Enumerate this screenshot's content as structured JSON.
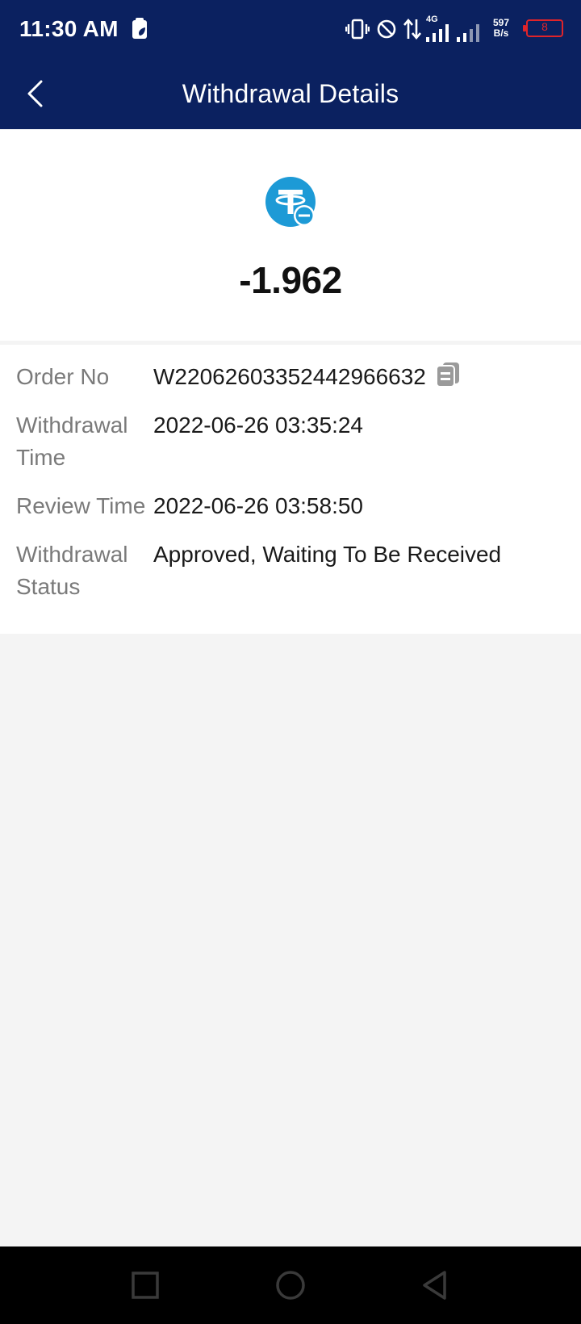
{
  "status_bar": {
    "time": "11:30 AM",
    "network": "4G",
    "speed_value": "597",
    "speed_unit": "B/s",
    "battery": "8"
  },
  "header": {
    "title": "Withdrawal Details",
    "background": "#0b2160"
  },
  "summary": {
    "coin_icon": "tether-withdraw-icon",
    "amount": "-1.962",
    "accent": "#1d9ad6"
  },
  "details": {
    "rows": [
      {
        "label": "Order No",
        "value": "W2206260335244296663​2"
      },
      {
        "label": "Withdrawal Time",
        "value": "2022-06-26 03:35:24"
      },
      {
        "label": "Review Time",
        "value": "2022-06-26 03:58:50"
      },
      {
        "label": "Withdrawal Status",
        "value": "Approved, Waiting To Be Received"
      }
    ],
    "copy_icon": "copy-icon"
  },
  "nav": {
    "icons": [
      "recents-square-icon",
      "home-circle-icon",
      "back-triangle-icon"
    ]
  }
}
